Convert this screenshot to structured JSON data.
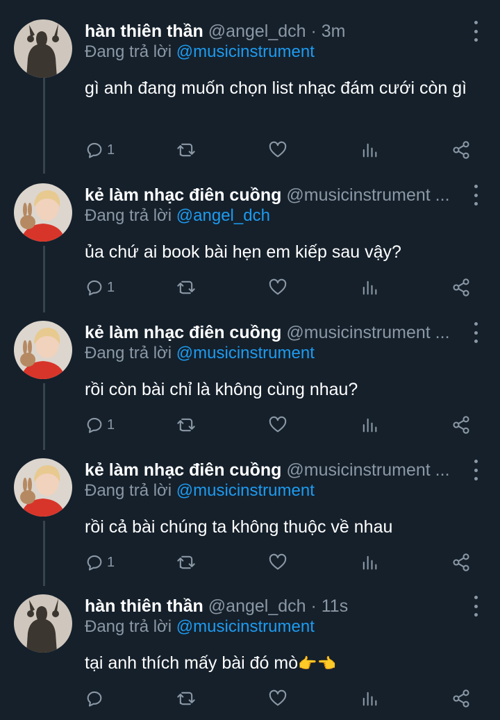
{
  "colors": {
    "background": "#15202b",
    "secondary_text": "#8b98a5",
    "link": "#1d9bf0",
    "thread_line": "#38444d"
  },
  "tweets": [
    {
      "name": "hàn thiên thần",
      "handle": "@angel_dch · 3m",
      "reply_prefix": "Đang trả lời",
      "reply_to": "@musicinstrument",
      "text": "gì anh đang muốn chọn list nhạc đám cưới còn gì",
      "reply_count": "1",
      "avatar": "silhouette-avatar"
    },
    {
      "name": "kẻ làm nhạc điên cuồng",
      "handle": "@musicinstrument ...",
      "reply_prefix": "Đang trả lời",
      "reply_to": "@angel_dch",
      "text": "ủa chứ ai book bài hẹn em kiếp sau vậy?",
      "reply_count": "1",
      "avatar": "person-with-rabbit-avatar"
    },
    {
      "name": "kẻ làm nhạc điên cuồng",
      "handle": "@musicinstrument ...",
      "reply_prefix": "Đang trả lời",
      "reply_to": "@musicinstrument",
      "text": "rồi còn bài chỉ là không cùng nhau?",
      "reply_count": "1",
      "avatar": "person-with-rabbit-avatar"
    },
    {
      "name": "kẻ làm nhạc điên cuồng",
      "handle": "@musicinstrument ...",
      "reply_prefix": "Đang trả lời",
      "reply_to": "@musicinstrument",
      "text": "rồi cả bài chúng ta không thuộc về nhau",
      "reply_count": "1",
      "avatar": "person-with-rabbit-avatar"
    },
    {
      "name": "hàn thiên thần",
      "handle": "@angel_dch · 11s",
      "reply_prefix": "Đang trả lời",
      "reply_to": "@musicinstrument",
      "text": "tại anh thích mấy bài đó mò",
      "text_emoji": "👉👈",
      "reply_count": "",
      "avatar": "silhouette-avatar"
    }
  ]
}
